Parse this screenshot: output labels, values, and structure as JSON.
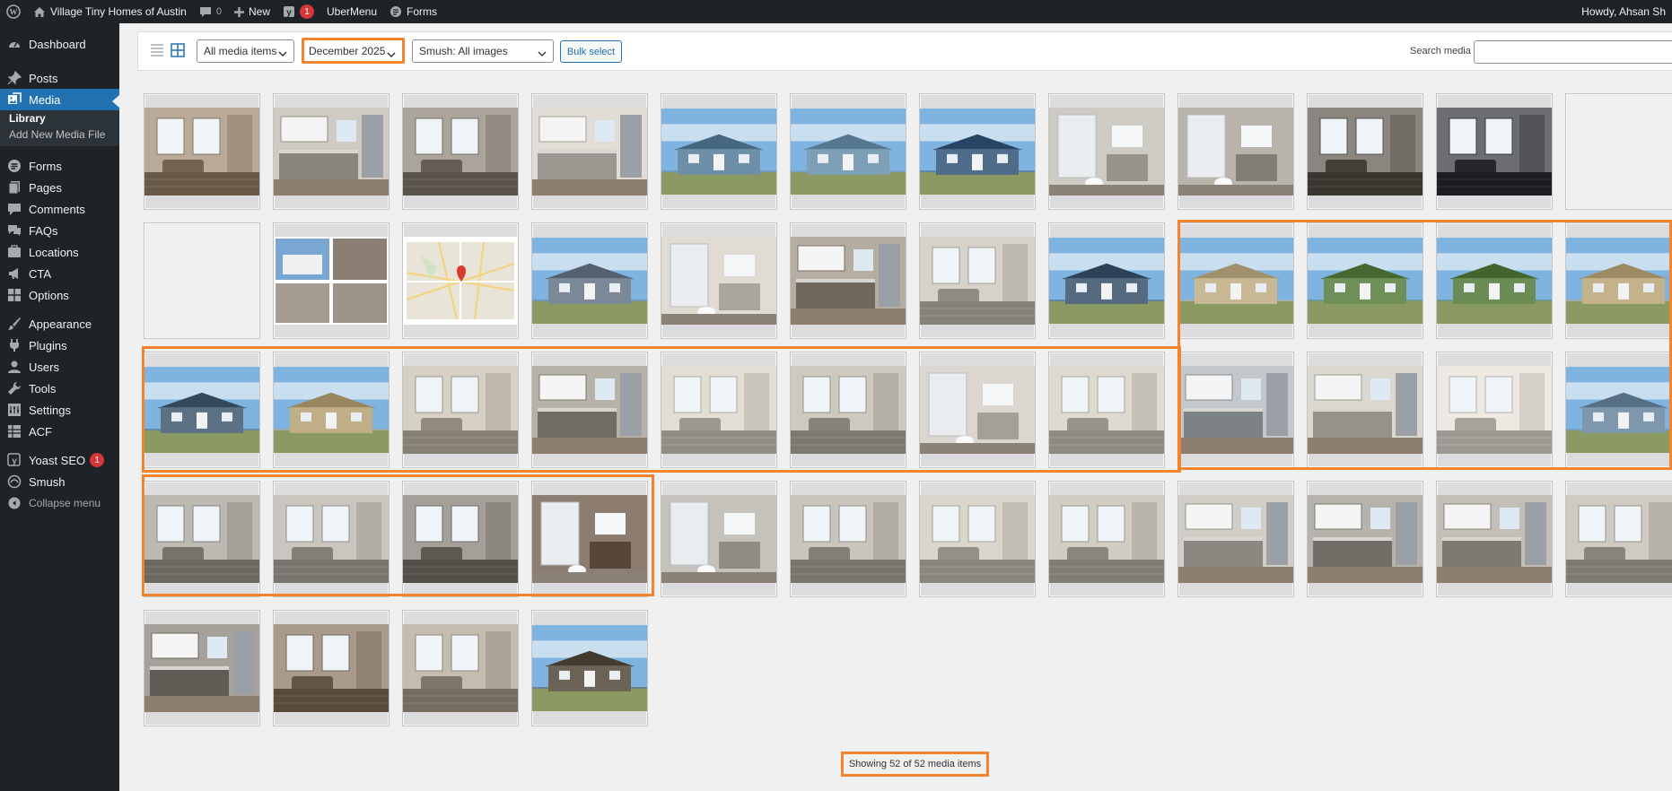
{
  "admin_bar": {
    "site_name": "Village Tiny Homes of Austin",
    "comments_count": "0",
    "new_label": "New",
    "yoast_count": "1",
    "ubermenu_label": "UberMenu",
    "forms_label": "Forms",
    "howdy": "Howdy, Ahsan Sh"
  },
  "sidebar": {
    "dashboard": "Dashboard",
    "posts": "Posts",
    "media": "Media",
    "library": "Library",
    "add_new": "Add New Media File",
    "forms": "Forms",
    "pages": "Pages",
    "comments": "Comments",
    "faqs": "FAQs",
    "locations": "Locations",
    "cta": "CTA",
    "options": "Options",
    "appearance": "Appearance",
    "plugins": "Plugins",
    "users": "Users",
    "tools": "Tools",
    "settings": "Settings",
    "acf": "ACF",
    "yoast": "Yoast SEO",
    "yoast_badge": "1",
    "smush": "Smush",
    "collapse": "Collapse menu"
  },
  "toolbar": {
    "filter_type": "All media items",
    "filter_date": "December 2025",
    "filter_smush": "Smush: All images",
    "bulk_select": "Bulk select",
    "search_label": "Search media",
    "search_value": ""
  },
  "status": {
    "text": "Showing 52 of 52 media items"
  },
  "colors": {
    "highlight": "#f28430",
    "admin_bg": "#1d2327",
    "accent": "#2271b1"
  },
  "media_items": [
    {
      "kind": "interior",
      "tone": "#8c7d6b"
    },
    {
      "kind": "kitchen",
      "tone": "#a8a39a"
    },
    {
      "kind": "interior",
      "tone": "#7d776e"
    },
    {
      "kind": "kitchen",
      "tone": "#b9b5ae"
    },
    {
      "kind": "house",
      "tone": "#6e8fa8"
    },
    {
      "kind": "house",
      "tone": "#7da0b6"
    },
    {
      "kind": "house",
      "tone": "#4f6c8a"
    },
    {
      "kind": "bathroom",
      "tone": "#b0aca6"
    },
    {
      "kind": "bathroom",
      "tone": "#9a958d"
    },
    {
      "kind": "interior",
      "tone": "#5d5852"
    },
    {
      "kind": "interior",
      "tone": "#3e4046"
    },
    {
      "kind": "blank",
      "tone": "#f0f0f1"
    },
    {
      "kind": "blank",
      "tone": "#f0f0f1"
    },
    {
      "kind": "collage",
      "tone": "#6b7f94"
    },
    {
      "kind": "map",
      "tone": "#e8e4d8"
    },
    {
      "kind": "house",
      "tone": "#7a8898"
    },
    {
      "kind": "bathroom",
      "tone": "#c2beb6"
    },
    {
      "kind": "kitchen",
      "tone": "#8d8579"
    },
    {
      "kind": "interior",
      "tone": "#aaa59c"
    },
    {
      "kind": "house",
      "tone": "#556a7e"
    },
    {
      "kind": "house",
      "tone": "#c9b894"
    },
    {
      "kind": "house",
      "tone": "#6f8f58"
    },
    {
      "kind": "house",
      "tone": "#6b8c55"
    },
    {
      "kind": "house",
      "tone": "#c4b28a"
    },
    {
      "kind": "house",
      "tone": "#5d7185"
    },
    {
      "kind": "house",
      "tone": "#bfae86"
    },
    {
      "kind": "interior",
      "tone": "#a9a398"
    },
    {
      "kind": "kitchen",
      "tone": "#8f8a80"
    },
    {
      "kind": "interior",
      "tone": "#b6b1a6"
    },
    {
      "kind": "interior",
      "tone": "#a19c92"
    },
    {
      "kind": "bathroom",
      "tone": "#bdb9b2"
    },
    {
      "kind": "interior",
      "tone": "#b2ada3"
    },
    {
      "kind": "kitchen",
      "tone": "#9aa0a4"
    },
    {
      "kind": "kitchen",
      "tone": "#b3b0a8"
    },
    {
      "kind": "interior",
      "tone": "#c0bcb5"
    },
    {
      "kind": "house",
      "tone": "#7f97ad"
    },
    {
      "kind": "interior",
      "tone": "#8f8b85"
    },
    {
      "kind": "interior",
      "tone": "#9d9992"
    },
    {
      "kind": "interior",
      "tone": "#77736c"
    },
    {
      "kind": "bathroom",
      "tone": "#6f5f52"
    },
    {
      "kind": "bathroom",
      "tone": "#a7a49e"
    },
    {
      "kind": "interior",
      "tone": "#9c978f"
    },
    {
      "kind": "interior",
      "tone": "#aea99f"
    },
    {
      "kind": "interior",
      "tone": "#a5a096"
    },
    {
      "kind": "kitchen",
      "tone": "#a9a6a0"
    },
    {
      "kind": "kitchen",
      "tone": "#8e8a84"
    },
    {
      "kind": "kitchen",
      "tone": "#9b978f"
    },
    {
      "kind": "interior",
      "tone": "#a29e96"
    },
    {
      "kind": "kitchen",
      "tone": "#7e7a73"
    },
    {
      "kind": "interior",
      "tone": "#7b6e5e"
    },
    {
      "kind": "interior",
      "tone": "#978f82"
    },
    {
      "kind": "house",
      "tone": "#6b6356"
    }
  ]
}
